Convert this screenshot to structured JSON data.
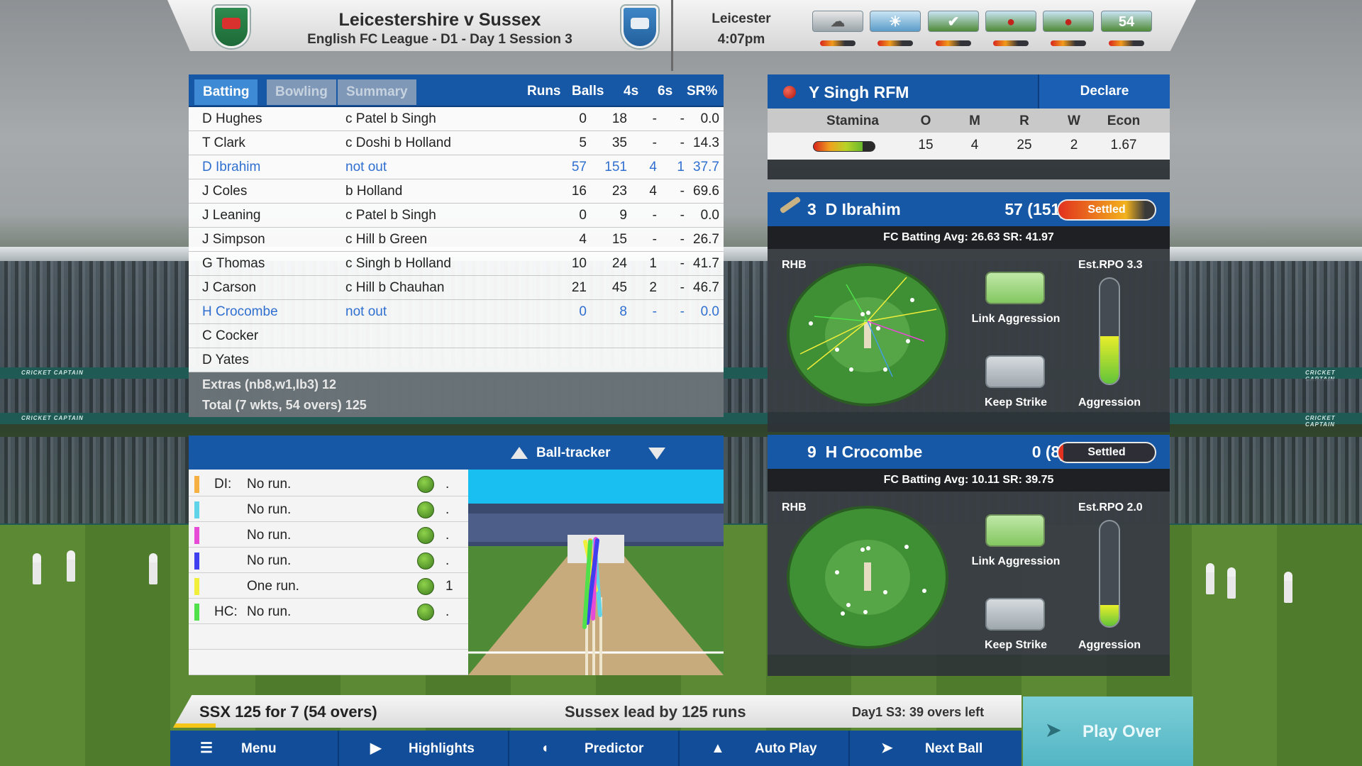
{
  "header": {
    "match_title": "Leicestershire v Sussex",
    "match_subtitle": "English FC League - D1 - Day 1 Session 3",
    "venue": "Leicester",
    "time": "4:07pm",
    "conditions": [
      "cloud",
      "sun",
      "pitch",
      "ball",
      "outfield",
      "54"
    ],
    "overs_badge": "54"
  },
  "batting_card": {
    "tabs": [
      "Batting",
      "Bowling",
      "Summary"
    ],
    "columns": [
      "Runs",
      "Balls",
      "4s",
      "6s",
      "SR%"
    ],
    "rows": [
      {
        "name": "D Hughes",
        "how_out": "c Patel b Singh",
        "runs": "0",
        "balls": "18",
        "fours": "-",
        "sixes": "-",
        "sr": "0.0"
      },
      {
        "name": "T Clark",
        "how_out": "c Doshi b Holland",
        "runs": "5",
        "balls": "35",
        "fours": "-",
        "sixes": "-",
        "sr": "14.3"
      },
      {
        "name": "D Ibrahim",
        "how_out": "not out",
        "runs": "57",
        "balls": "151",
        "fours": "4",
        "sixes": "1",
        "sr": "37.7"
      },
      {
        "name": "J Coles",
        "how_out": "b Holland",
        "runs": "16",
        "balls": "23",
        "fours": "4",
        "sixes": "-",
        "sr": "69.6"
      },
      {
        "name": "J Leaning",
        "how_out": "c Patel b Singh",
        "runs": "0",
        "balls": "9",
        "fours": "-",
        "sixes": "-",
        "sr": "0.0"
      },
      {
        "name": "J Simpson",
        "how_out": "c Hill b Green",
        "runs": "4",
        "balls": "15",
        "fours": "-",
        "sixes": "-",
        "sr": "26.7"
      },
      {
        "name": "G Thomas",
        "how_out": "c Singh b Holland",
        "runs": "10",
        "balls": "24",
        "fours": "1",
        "sixes": "-",
        "sr": "41.7"
      },
      {
        "name": "J Carson",
        "how_out": "c Hill b Chauhan",
        "runs": "21",
        "balls": "45",
        "fours": "2",
        "sixes": "-",
        "sr": "46.7"
      },
      {
        "name": "H Crocombe",
        "how_out": "not out",
        "runs": "0",
        "balls": "8",
        "fours": "-",
        "sixes": "-",
        "sr": "0.0"
      },
      {
        "name": "C Cocker",
        "how_out": "",
        "runs": "",
        "balls": "",
        "fours": "",
        "sixes": "",
        "sr": ""
      },
      {
        "name": "D Yates",
        "how_out": "",
        "runs": "",
        "balls": "",
        "fours": "",
        "sixes": "",
        "sr": ""
      }
    ],
    "extras": "Extras (nb8,w1,lb3) 12",
    "total": "Total (7 wkts, 54 overs) 125"
  },
  "bowler": {
    "name": "Y Singh  RFM",
    "declare_label": "Declare",
    "columns": [
      "Stamina",
      "O",
      "M",
      "R",
      "W",
      "Econ"
    ],
    "values": {
      "overs": "15",
      "maidens": "4",
      "runs": "25",
      "wickets": "2",
      "econ": "1.67"
    },
    "stamina_level": 0.8
  },
  "batsmen": [
    {
      "number": "3",
      "name": "D Ibrahim",
      "score": "57 (151)",
      "state": "Settled",
      "avg_line": "FC Batting Avg: 26.63   SR: 41.97",
      "hand": "RHB",
      "est_rpo": "Est.RPO  3.3",
      "link_label": "Link Aggression",
      "strike_label": "Keep Strike",
      "aggression_label": "Aggression",
      "aggression_level": 0.45
    },
    {
      "number": "9",
      "name": "H Crocombe",
      "score": "0 (8)",
      "state": "Settled",
      "avg_line": "FC Batting Avg: 10.11   SR: 39.75",
      "hand": "RHB",
      "est_rpo": "Est.RPO  2.0",
      "link_label": "Link Aggression",
      "strike_label": "Keep Strike",
      "aggression_label": "Aggression",
      "aggression_level": 0.2
    }
  ],
  "ball_tracker": {
    "title": "Ball-tracker",
    "rows": [
      {
        "who": "DI:",
        "desc": "No run.",
        "result": ".",
        "color": "#f5b041"
      },
      {
        "who": "",
        "desc": "No run.",
        "result": ".",
        "color": "#5fd3e8"
      },
      {
        "who": "",
        "desc": "No run.",
        "result": ".",
        "color": "#e84ad8"
      },
      {
        "who": "",
        "desc": "No run.",
        "result": ".",
        "color": "#3f3ff0"
      },
      {
        "who": "",
        "desc": "One run.",
        "result": "1",
        "color": "#f2ef3a"
      },
      {
        "who": "HC:",
        "desc": "No run.",
        "result": ".",
        "color": "#4fe04a"
      }
    ]
  },
  "status": {
    "score": "SSX  125 for 7   (54 overs)",
    "lead": "Sussex lead by 125 runs",
    "session": "Day1 S3: 39 overs left"
  },
  "menu": {
    "items": [
      "Menu",
      "Highlights",
      "Predictor",
      "Auto Play",
      "Next Ball"
    ],
    "play_over": "Play Over"
  },
  "board_text": "CRICKET CAPTAIN"
}
